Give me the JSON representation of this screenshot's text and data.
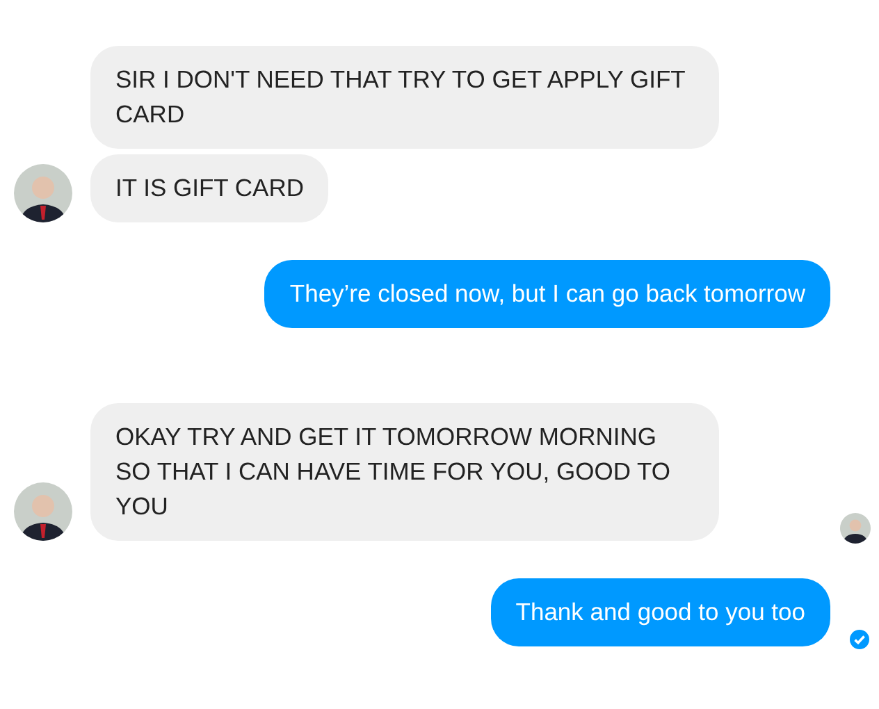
{
  "conversation": [
    {
      "kind": "incoming",
      "messages": [
        "SIR I DON'T NEED THAT TRY TO GET APPLY GIFT CARD",
        "IT IS GIFT CARD"
      ],
      "seen": false,
      "delivered": false
    },
    {
      "kind": "outgoing",
      "messages": [
        "They’re closed now, but I can go back tomorrow"
      ],
      "seen": false,
      "delivered": false
    },
    {
      "kind": "incoming",
      "messages": [
        "OKAY TRY AND GET IT TOMORROW MORNING SO THAT I CAN HAVE TIME FOR YOU, GOOD TO YOU"
      ],
      "seen": true,
      "delivered": false
    },
    {
      "kind": "outgoing",
      "messages": [
        "Thank and good to you too"
      ],
      "seen": false,
      "delivered": true
    }
  ]
}
